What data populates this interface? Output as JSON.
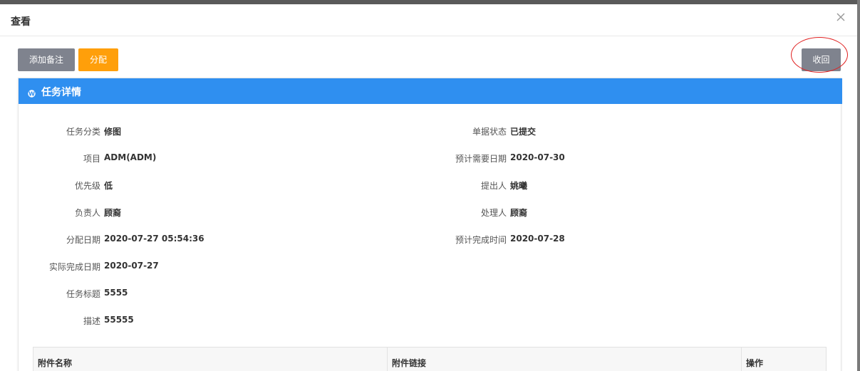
{
  "modal": {
    "title": "查看"
  },
  "toolbar": {
    "add_note_label": "添加备注",
    "assign_label": "分配",
    "withdraw_label": "收回"
  },
  "panel": {
    "title": "任务详情"
  },
  "details_left": [
    {
      "label": "任务分类",
      "value": "修图"
    },
    {
      "label": "项目",
      "value": "ADM(ADM)"
    },
    {
      "label": "优先级",
      "value": "低"
    },
    {
      "label": "负责人",
      "value": "顾裔"
    },
    {
      "label": "分配日期",
      "value": "2020-07-27 05:54:36"
    },
    {
      "label": "实际完成日期",
      "value": "2020-07-27"
    },
    {
      "label": "任务标题",
      "value": "5555"
    },
    {
      "label": "描述",
      "value": "55555"
    }
  ],
  "details_right": [
    {
      "label": "单据状态",
      "value": "已提交"
    },
    {
      "label": "预计需要日期",
      "value": "2020-07-30"
    },
    {
      "label": "提出人",
      "value": "姚曦"
    },
    {
      "label": "处理人",
      "value": "顾裔"
    },
    {
      "label": "预计完成时间",
      "value": "2020-07-28"
    }
  ],
  "attachments": {
    "columns": [
      "附件名称",
      "附件链接",
      "操作"
    ]
  },
  "colors": {
    "panel_header": "#2f8ff0",
    "btn_gray": "#7f838e",
    "btn_orange": "#ff9f0a",
    "annotation_circle": "#e02020"
  }
}
